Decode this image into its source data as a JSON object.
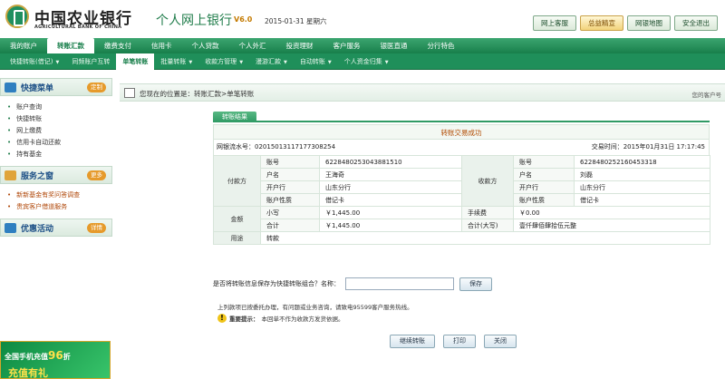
{
  "header": {
    "bank_name_cn": "中国农业银行",
    "bank_name_en": "AGRICULTURAL BANK OF CHINA",
    "system_title": "个人网上银行",
    "version": "V6.0",
    "date": "2015-01-31 星期六",
    "buttons": [
      "网上客服",
      "总益精宣",
      "网银地图",
      "安全退出"
    ]
  },
  "nav_main": [
    "我的账户",
    "转账汇款",
    "缴费支付",
    "信用卡",
    "个人贷款",
    "个人外汇",
    "投资理财",
    "客户服务",
    "银医直通",
    "分行特色"
  ],
  "nav_sub": [
    "快捷转账(借记)",
    "同频账户互转",
    "单笔转账",
    "批量转账",
    "收款方管理",
    "漫游汇款",
    "自动转账",
    "个人资金归集"
  ],
  "sidebar": {
    "quick_menu": {
      "title": "快捷菜单",
      "more": "定制",
      "items": [
        "账户查询",
        "快捷转账",
        "网上缴费",
        "信用卡自动还款",
        "持有基金"
      ]
    },
    "service": {
      "title": "服务之窗",
      "more": "更多",
      "items": [
        "新新基金有奖问答调查",
        "贵宾客户借道服务"
      ]
    },
    "offers": {
      "title": "优惠活动",
      "more": "详情"
    },
    "ad": {
      "line1": "全国手机充值",
      "big": "96",
      "suffix": "折",
      "line2": "充值有礼"
    }
  },
  "breadcrumb": {
    "text": "您现在的位置是：转账汇款>单笔转账",
    "right": "您的客户号"
  },
  "tab": "转账结果",
  "result": {
    "title": "转账交易成功",
    "serial_label": "网银流水号：",
    "serial": "020150131171773082​54",
    "time_label": "交易时间：",
    "time": "2015年01月31日 17:17:45",
    "payer_label": "付款方",
    "payee_label": "收款方",
    "payer": [
      {
        "k": "账号",
        "v": "6228480253043881510"
      },
      {
        "k": "户名",
        "v": "王海奇"
      },
      {
        "k": "开户行",
        "v": "山东分行"
      },
      {
        "k": "账户性质",
        "v": "借记卡"
      }
    ],
    "payee": [
      {
        "k": "账号",
        "v": "6228480252160453318"
      },
      {
        "k": "户名",
        "v": "刘磊"
      },
      {
        "k": "开户行",
        "v": "山东分行"
      },
      {
        "k": "账户性质",
        "v": "借记卡"
      }
    ],
    "amount_label": "金额",
    "small_label": "小写",
    "small": "￥1,445.00",
    "total_label": "合计",
    "total": "￥1,445.00",
    "fee_label": "手续费",
    "fee": "￥0.00",
    "total_upper_label": "合计(大写)",
    "total_upper": "壹仟肆佰肆拾伍元整",
    "purpose_label": "用途",
    "purpose": "转款"
  },
  "save": {
    "question": "是否将转账信息保存为快捷转账组合？名称：",
    "input_value": "",
    "button": "保存"
  },
  "notes": {
    "line1": "上列款项已按委托办理，有问题或业务咨询，请致电95599客户服务热线。",
    "bold": "重要提示：",
    "line2": "本回单不作为收款方发货依据。"
  },
  "actions": [
    "继续转账",
    "打印",
    "关闭"
  ],
  "colors": {
    "brand_green": "#1f8f5a",
    "accent_orange": "#b14a00"
  }
}
